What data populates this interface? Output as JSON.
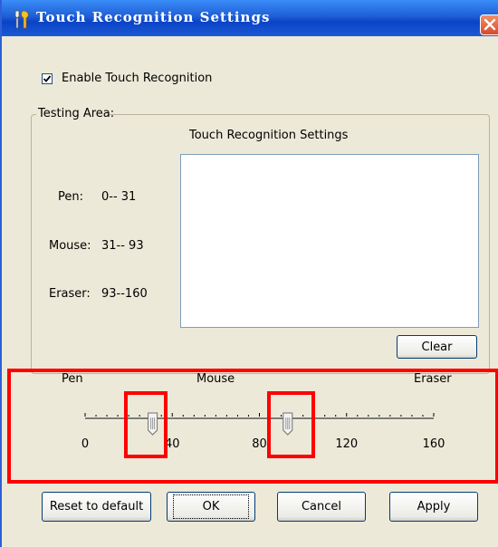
{
  "window": {
    "title": "Touch Recognition Settings"
  },
  "enable": {
    "label": "Enable Touch Recognition",
    "checked": true
  },
  "testing_area": {
    "label": "Testing Area:",
    "heading": "Touch Recognition Settings",
    "ranges": [
      {
        "name": "Pen:",
        "range": "0-- 31"
      },
      {
        "name": "Mouse:",
        "range": "31-- 93"
      },
      {
        "name": "Eraser:",
        "range": "93--160"
      }
    ],
    "clear_label": "Clear"
  },
  "slider": {
    "zone_labels": {
      "pen": "Pen",
      "mouse": "Mouse",
      "eraser": "Eraser"
    },
    "min": 0,
    "max": 160,
    "tick_labels": [
      "0",
      "40",
      "80",
      "120",
      "160"
    ],
    "thumb1_value": 31,
    "thumb2_value": 93
  },
  "buttons": {
    "reset": "Reset to default",
    "ok": "OK",
    "cancel": "Cancel",
    "apply": "Apply"
  },
  "colors": {
    "titlebar": "#1f5fd6",
    "highlight": "#ff0000",
    "window_bg": "#ece9d8"
  }
}
